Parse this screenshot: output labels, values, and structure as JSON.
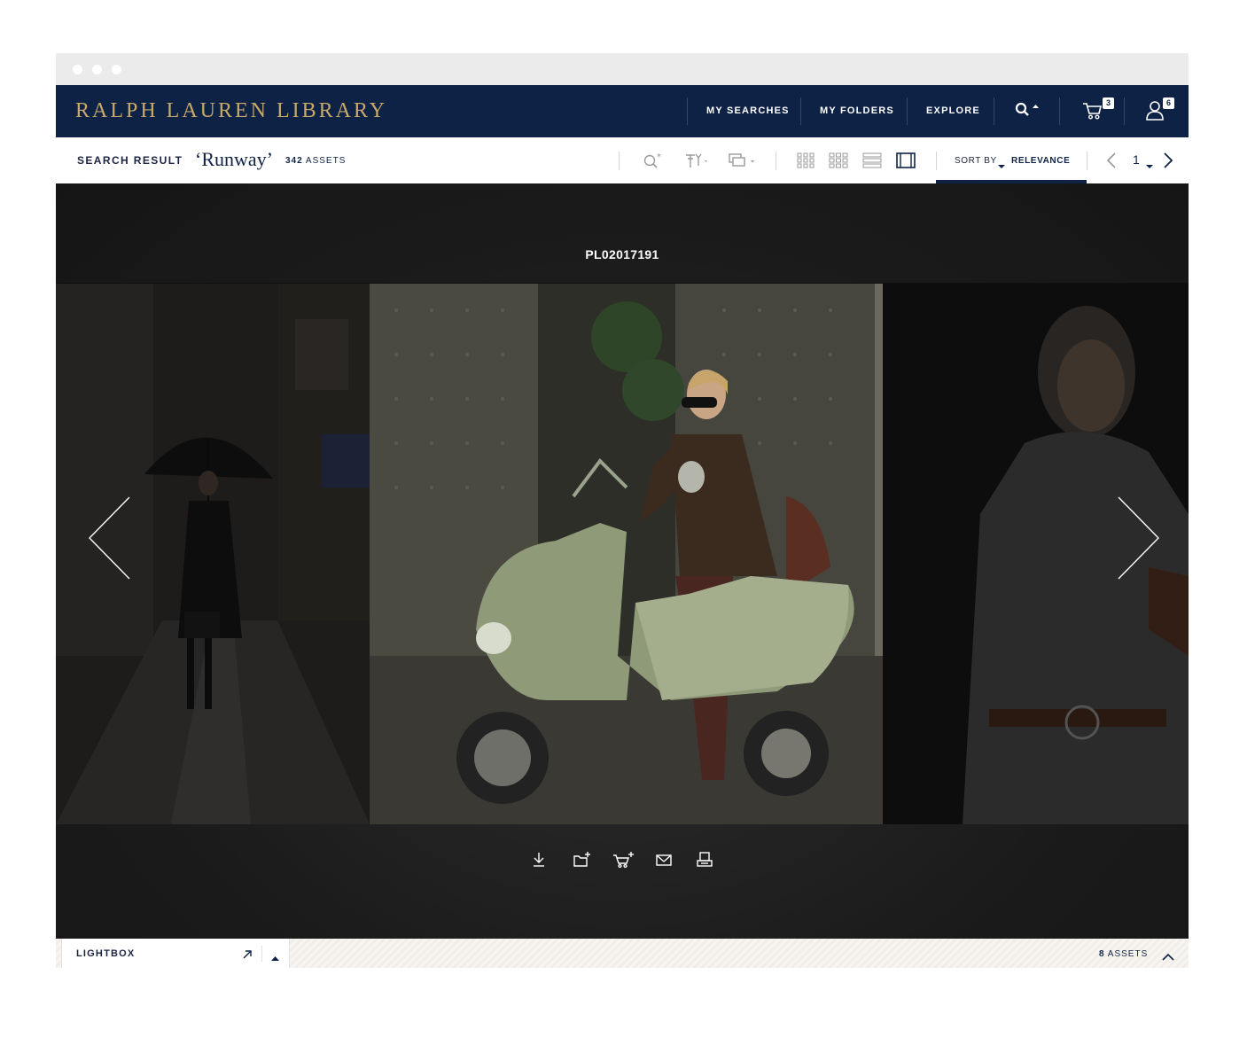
{
  "brand": {
    "logo_text": "RALPH LAUREN LIBRARY",
    "logo_color": "#c8a96a",
    "nav_bg": "#0e2245"
  },
  "nav": {
    "items": [
      {
        "label": "MY SEARCHES"
      },
      {
        "label": "MY FOLDERS"
      },
      {
        "label": "EXPLORE"
      }
    ],
    "search_icon": "search-icon",
    "cart": {
      "icon": "cart-icon",
      "badge": "3"
    },
    "user": {
      "icon": "user-icon",
      "badge": "6"
    }
  },
  "toolbar": {
    "label": "SEARCH RESULT",
    "query": "‘Runway’",
    "count_num": "342",
    "count_label": "ASSETS",
    "sort_label": "SORT BY",
    "sort_value": "RELEVANCE",
    "page": "1",
    "icons": [
      "zoom-search-icon",
      "filter-icon",
      "stack-icon",
      "grid-small-icon",
      "grid-medium-icon",
      "list-view-icon",
      "single-view-icon"
    ]
  },
  "viewer": {
    "asset_id": "PL02017191",
    "actions": [
      "download-icon",
      "add-folder-icon",
      "add-cart-icon",
      "email-icon",
      "print-icon"
    ]
  },
  "lightbox": {
    "label": "LIGHTBOX",
    "count_num": "8",
    "count_label": "ASSETS"
  }
}
